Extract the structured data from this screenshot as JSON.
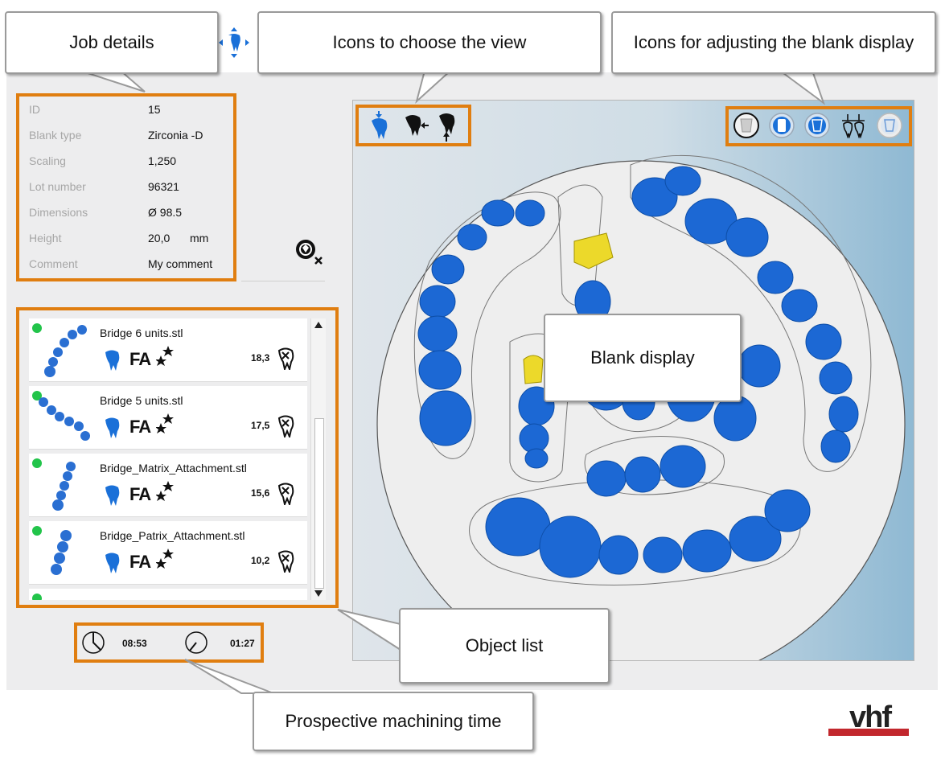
{
  "callouts": {
    "job_details": "Job details",
    "view_icons": "Icons to choose the view",
    "blank_display_icons": "Icons for adjusting the blank display",
    "blank_display": "Blank display",
    "object_list": "Object list",
    "machining_time": "Prospective machining time"
  },
  "job": {
    "rows": [
      {
        "label": "ID",
        "value": "15"
      },
      {
        "label": "Blank type",
        "value": "Zirconia -D"
      },
      {
        "label": "Scaling",
        "value": "1,250"
      },
      {
        "label": "Lot number",
        "value": "96321"
      },
      {
        "label": "Dimensions",
        "value": "Ø 98.5"
      },
      {
        "label": "Height",
        "value": "20,0"
      },
      {
        "label": "Comment",
        "value": "My comment"
      }
    ],
    "height_unit": "mm"
  },
  "objects": [
    {
      "name": "Bridge 6 units.stl",
      "badge": "FA",
      "value": "18,3"
    },
    {
      "name": "Bridge 5 units.stl",
      "badge": "FA",
      "value": "17,5"
    },
    {
      "name": "Bridge_Matrix_Attachment.stl",
      "badge": "FA",
      "value": "15,6"
    },
    {
      "name": "Bridge_Patrix_Attachment.stl",
      "badge": "FA",
      "value": "10,2"
    }
  ],
  "times": {
    "total": "08:53",
    "remaining": "01:27"
  },
  "brand": "vhf",
  "colors": {
    "accent_orange": "#e07e10",
    "tooth_blue": "#1a70d8",
    "status_green": "#22c44a",
    "brand_red": "#c2272d"
  },
  "icons": {
    "view": [
      "tooth-top-view-icon",
      "tooth-side-view-icon",
      "tooth-bottom-view-icon"
    ],
    "blank_display": [
      "blank-outline-icon",
      "blank-front-icon",
      "blank-full-icon",
      "bridge-support-icon",
      "blank-transparent-icon"
    ]
  }
}
